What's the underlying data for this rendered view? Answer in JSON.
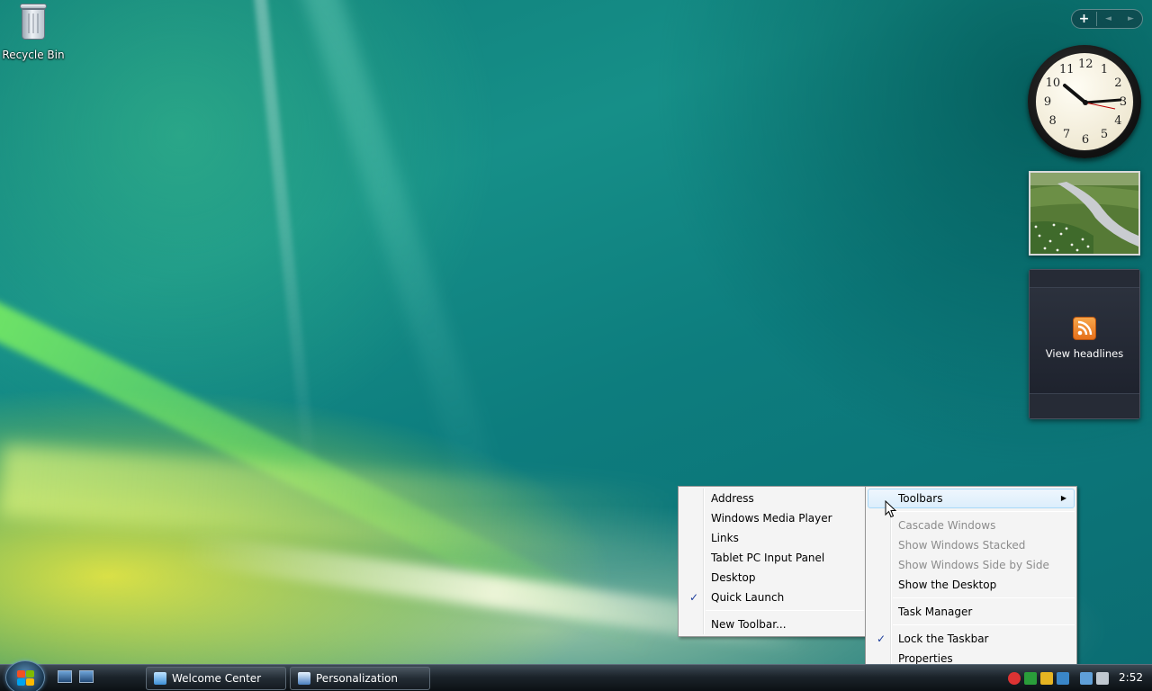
{
  "desktop": {
    "icons": [
      {
        "label": "Recycle Bin",
        "icon": "recycle-bin-icon"
      }
    ]
  },
  "sidebar": {
    "add_symbol": "+",
    "prev_symbol": "◄",
    "next_symbol": "►",
    "clock_numbers": [
      "12",
      "1",
      "2",
      "3",
      "4",
      "5",
      "6",
      "7",
      "8",
      "9",
      "10",
      "11"
    ],
    "feed_label": "View headlines"
  },
  "toolbars_menu": {
    "items": [
      {
        "label": "Address",
        "checked": false
      },
      {
        "label": "Windows Media Player",
        "checked": false
      },
      {
        "label": "Links",
        "checked": false
      },
      {
        "label": "Tablet PC Input Panel",
        "checked": false
      },
      {
        "label": "Desktop",
        "checked": false
      },
      {
        "label": "Quick Launch",
        "checked": true
      }
    ],
    "new_toolbar": "New Toolbar..."
  },
  "taskbar_menu": {
    "toolbars": "Toolbars",
    "cascade": "Cascade Windows",
    "stacked": "Show Windows Stacked",
    "side_by_side": "Show Windows Side by Side",
    "show_desktop": "Show the Desktop",
    "task_manager": "Task Manager",
    "lock": "Lock the Taskbar",
    "properties": "Properties",
    "check_mark": "✓",
    "submenu_arrow": "▶"
  },
  "taskbar": {
    "buttons": [
      {
        "label": "Welcome Center",
        "icon": "welcome-center-icon"
      },
      {
        "label": "Personalization",
        "icon": "personalization-icon"
      }
    ],
    "time": "2:52"
  },
  "colors": {
    "menu_bg": "#f4f4f4",
    "hover_border": "#a8d8f8",
    "disabled_text": "#8c8c8c",
    "check": "#1c3d9c"
  }
}
